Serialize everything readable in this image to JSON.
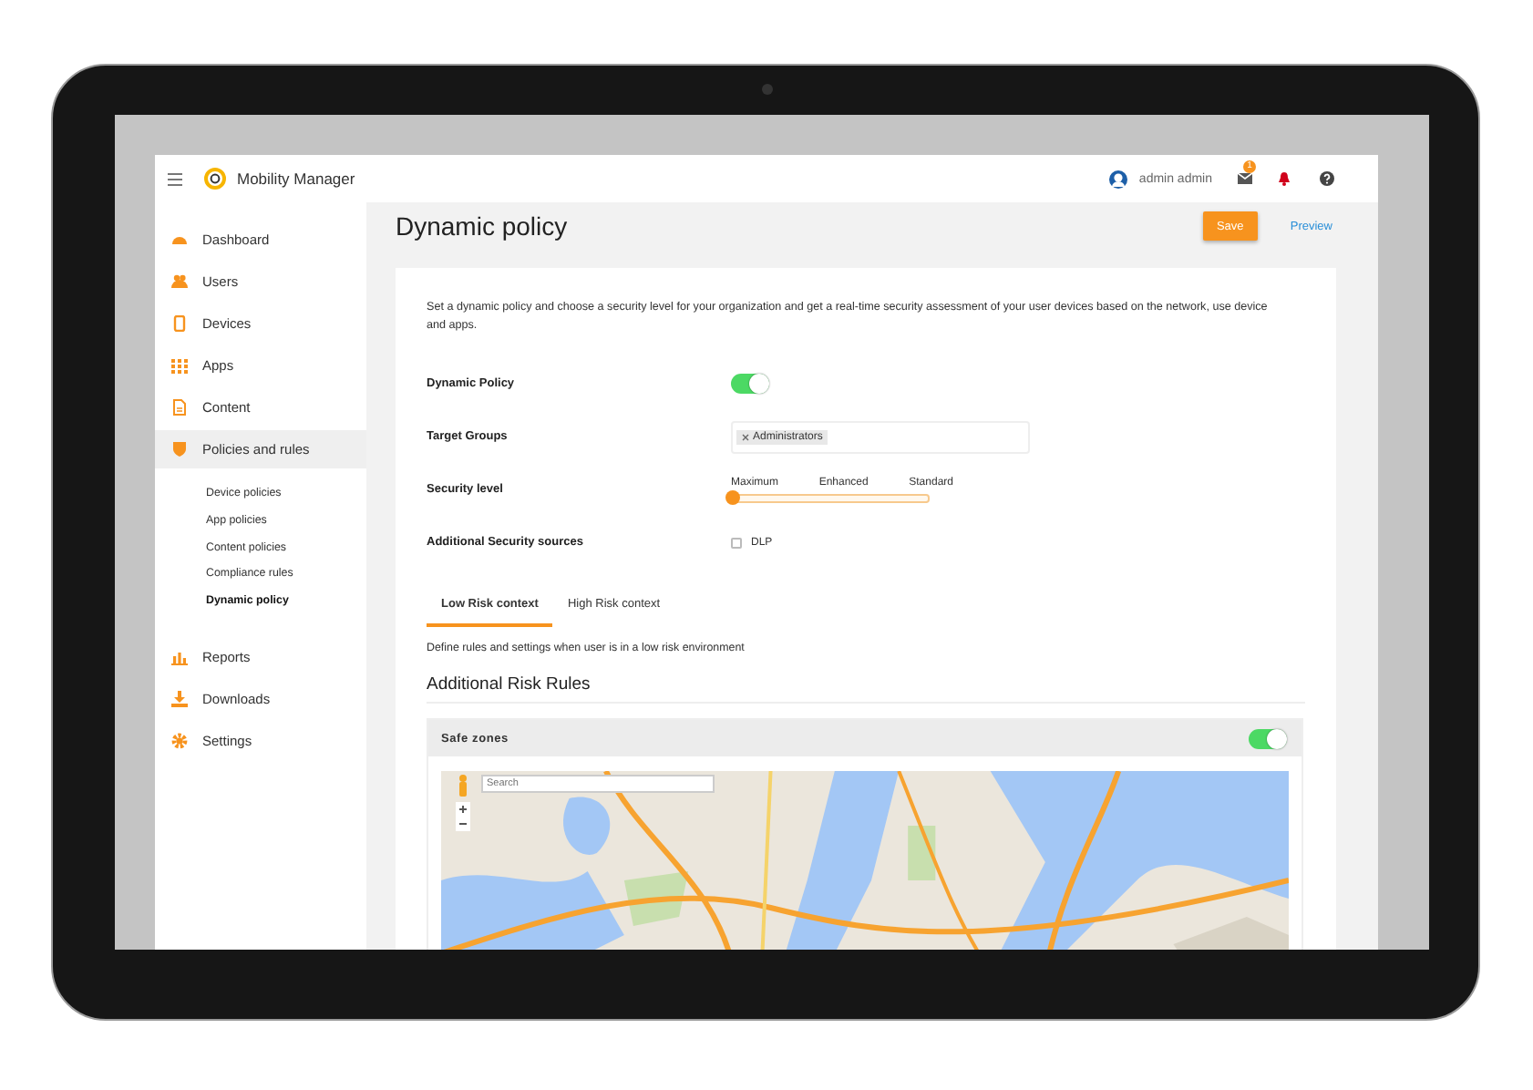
{
  "app": {
    "title": "Mobility Manager"
  },
  "header": {
    "user": "admin admin",
    "mail_badge": "1"
  },
  "sidebar": {
    "items": [
      {
        "label": "Dashboard",
        "selected": false
      },
      {
        "label": "Users",
        "selected": false
      },
      {
        "label": "Devices",
        "selected": false
      },
      {
        "label": "Apps",
        "selected": false
      },
      {
        "label": "Content",
        "selected": false
      },
      {
        "label": "Policies and rules",
        "selected": true,
        "children": [
          {
            "label": "Device policies",
            "selected": false
          },
          {
            "label": "App policies",
            "selected": false
          },
          {
            "label": "Content policies",
            "selected": false
          },
          {
            "label": "Compliance rules",
            "selected": false
          },
          {
            "label": "Dynamic policy",
            "selected": true
          }
        ]
      },
      {
        "label": "Reports",
        "selected": false
      },
      {
        "label": "Downloads",
        "selected": false
      },
      {
        "label": "Settings",
        "selected": false
      }
    ]
  },
  "page": {
    "title": "Dynamic policy",
    "save": "Save",
    "preview": "Preview",
    "description": "Set a dynamic policy and choose a security level for your organization and get a real-time security assessment of your user devices based on the network, use device and apps.",
    "fields": [
      {
        "kind": "toggle",
        "label": "Dynamic Policy",
        "on": true
      },
      {
        "kind": "tags",
        "label": "Target Groups",
        "tags": [
          "Administrators"
        ]
      },
      {
        "kind": "slider",
        "label": "Security level",
        "options": [
          "Maximum",
          "Enhanced",
          "Standard"
        ],
        "level": 0
      },
      {
        "kind": "checkbox",
        "label": "Additional Security sources",
        "options": [
          {
            "label": "DLP",
            "checked": false
          }
        ]
      }
    ],
    "tabs": [
      {
        "label": "Low Risk context",
        "selected": true
      },
      {
        "label": "High Risk context",
        "selected": false
      }
    ],
    "tab_description": "Define rules and settings when user is in a low risk environment",
    "section_title": "Additional Risk Rules",
    "panel": {
      "title": "Safe zones",
      "on": true,
      "map": {
        "kind": "picture",
        "search_placeholder": "Search"
      }
    }
  }
}
